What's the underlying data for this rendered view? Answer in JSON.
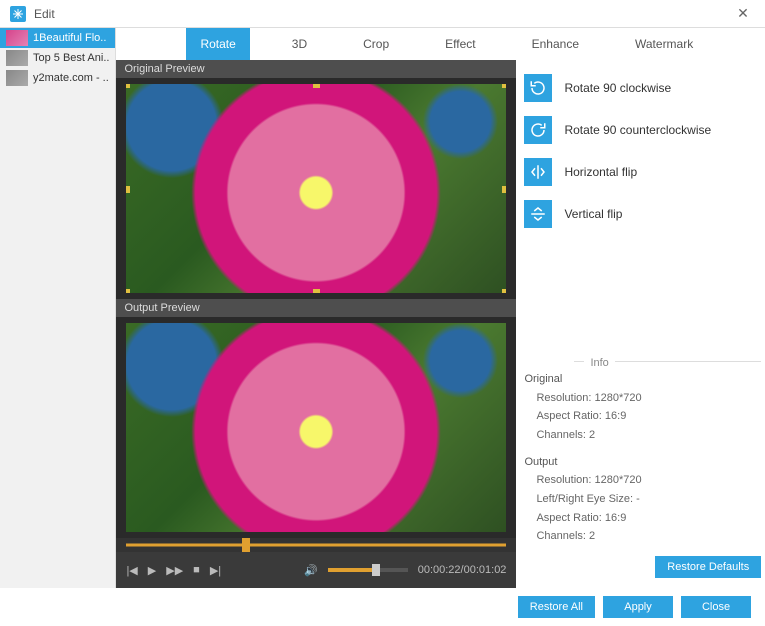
{
  "windowTitle": "Edit",
  "closeGlyph": "✕",
  "files": [
    {
      "name": "1Beautiful Flo..",
      "selected": true
    },
    {
      "name": "Top 5 Best Ani..",
      "selected": false
    },
    {
      "name": "y2mate.com - ..",
      "selected": false
    }
  ],
  "tabs": [
    {
      "label": "Rotate",
      "active": true
    },
    {
      "label": "3D",
      "active": false
    },
    {
      "label": "Crop",
      "active": false
    },
    {
      "label": "Effect",
      "active": false
    },
    {
      "label": "Enhance",
      "active": false
    },
    {
      "label": "Watermark",
      "active": false
    }
  ],
  "previewLabels": {
    "original": "Original Preview",
    "output": "Output Preview"
  },
  "operations": [
    {
      "id": "rotate-cw",
      "label": "Rotate 90 clockwise"
    },
    {
      "id": "rotate-ccw",
      "label": "Rotate 90 counterclockwise"
    },
    {
      "id": "flip-h",
      "label": "Horizontal flip"
    },
    {
      "id": "flip-v",
      "label": "Vertical flip"
    }
  ],
  "info": {
    "heading": "Info",
    "original": {
      "heading": "Original",
      "resolution": "Resolution: 1280*720",
      "aspect": "Aspect Ratio: 16:9",
      "channels": "Channels: 2"
    },
    "output": {
      "heading": "Output",
      "resolution": "Resolution: 1280*720",
      "eyeSize": "Left/Right Eye Size: -",
      "aspect": "Aspect Ratio: 16:9",
      "channels": "Channels: 2"
    }
  },
  "playback": {
    "position_pct": 30,
    "volume_pct": 60,
    "current": "00:00:22",
    "total": "00:01:02"
  },
  "buttons": {
    "restoreDefaults": "Restore Defaults",
    "restoreAll": "Restore All",
    "apply": "Apply",
    "close": "Close"
  }
}
